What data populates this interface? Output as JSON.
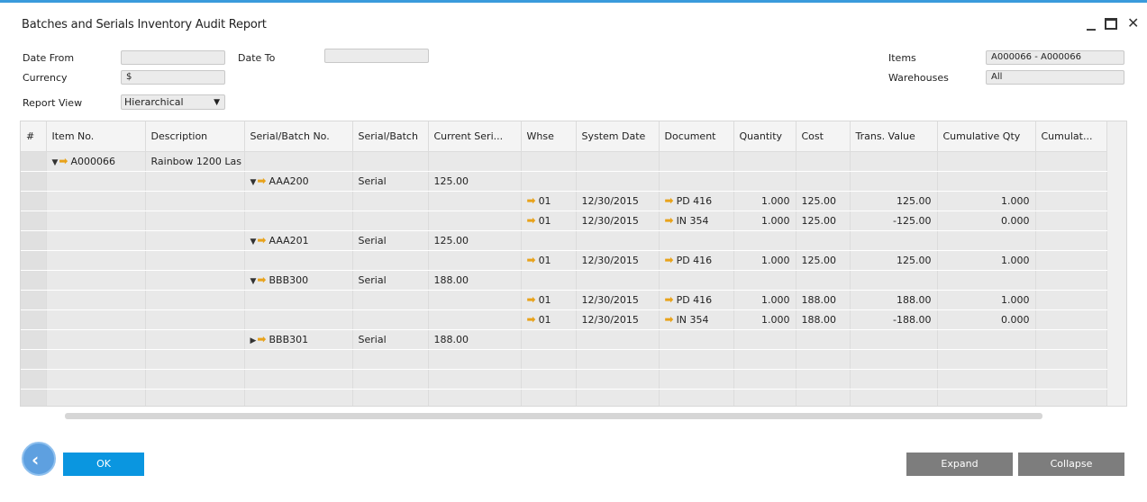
{
  "window": {
    "title": "Batches and Serials Inventory Audit Report"
  },
  "filters": {
    "date_from_label": "Date From",
    "date_from_value": "",
    "date_to_label": "Date To",
    "date_to_value": "",
    "currency_label": "Currency",
    "currency_value": "$",
    "report_view_label": "Report View",
    "report_view_value": "Hierarchical",
    "items_label": "Items",
    "items_value": "A000066 - A000066",
    "warehouses_label": "Warehouses",
    "warehouses_value": "All"
  },
  "grid": {
    "columns": [
      "#",
      "Item No.",
      "Description",
      "Serial/Batch No.",
      "Serial/Batch",
      "Current Seri...",
      "Whse",
      "System Date",
      "Document",
      "Quantity",
      "Cost",
      "Trans. Value",
      "Cumulative Qty",
      "Cumulat..."
    ],
    "rows": [
      {
        "item": "A000066",
        "item_exp": "down",
        "desc": "Rainbow 1200 Las",
        "sb": "",
        "sb_exp": "",
        "sbtype": "",
        "cur": "",
        "whse": "",
        "date": "",
        "doc": "",
        "qty": "",
        "cost": "",
        "tv": "",
        "cq": ""
      },
      {
        "item": "",
        "item_exp": "",
        "desc": "",
        "sb": "AAA200",
        "sb_exp": "down",
        "sbtype": "Serial",
        "cur": "125.00",
        "whse": "",
        "date": "",
        "doc": "",
        "qty": "",
        "cost": "",
        "tv": "",
        "cq": ""
      },
      {
        "item": "",
        "item_exp": "",
        "desc": "",
        "sb": "",
        "sb_exp": "",
        "sbtype": "",
        "cur": "",
        "whse": "01",
        "date": "12/30/2015",
        "doc": "PD 416",
        "qty": "1.000",
        "cost": "125.00",
        "tv": "125.00",
        "cq": "1.000"
      },
      {
        "item": "",
        "item_exp": "",
        "desc": "",
        "sb": "",
        "sb_exp": "",
        "sbtype": "",
        "cur": "",
        "whse": "01",
        "date": "12/30/2015",
        "doc": "IN 354",
        "qty": "1.000",
        "cost": "125.00",
        "tv": "-125.00",
        "cq": "0.000"
      },
      {
        "item": "",
        "item_exp": "",
        "desc": "",
        "sb": "AAA201",
        "sb_exp": "down",
        "sbtype": "Serial",
        "cur": "125.00",
        "whse": "",
        "date": "",
        "doc": "",
        "qty": "",
        "cost": "",
        "tv": "",
        "cq": ""
      },
      {
        "item": "",
        "item_exp": "",
        "desc": "",
        "sb": "",
        "sb_exp": "",
        "sbtype": "",
        "cur": "",
        "whse": "01",
        "date": "12/30/2015",
        "doc": "PD 416",
        "qty": "1.000",
        "cost": "125.00",
        "tv": "125.00",
        "cq": "1.000"
      },
      {
        "item": "",
        "item_exp": "",
        "desc": "",
        "sb": "BBB300",
        "sb_exp": "down",
        "sbtype": "Serial",
        "cur": "188.00",
        "whse": "",
        "date": "",
        "doc": "",
        "qty": "",
        "cost": "",
        "tv": "",
        "cq": ""
      },
      {
        "item": "",
        "item_exp": "",
        "desc": "",
        "sb": "",
        "sb_exp": "",
        "sbtype": "",
        "cur": "",
        "whse": "01",
        "date": "12/30/2015",
        "doc": "PD 416",
        "qty": "1.000",
        "cost": "188.00",
        "tv": "188.00",
        "cq": "1.000"
      },
      {
        "item": "",
        "item_exp": "",
        "desc": "",
        "sb": "",
        "sb_exp": "",
        "sbtype": "",
        "cur": "",
        "whse": "01",
        "date": "12/30/2015",
        "doc": "IN 354",
        "qty": "1.000",
        "cost": "188.00",
        "tv": "-188.00",
        "cq": "0.000"
      },
      {
        "item": "",
        "item_exp": "",
        "desc": "",
        "sb": "BBB301",
        "sb_exp": "right",
        "sbtype": "Serial",
        "cur": "188.00",
        "whse": "",
        "date": "",
        "doc": "",
        "qty": "",
        "cost": "",
        "tv": "",
        "cq": ""
      },
      {
        "item": "",
        "item_exp": "",
        "desc": "",
        "sb": "",
        "sb_exp": "",
        "sbtype": "",
        "cur": "",
        "whse": "",
        "date": "",
        "doc": "",
        "qty": "",
        "cost": "",
        "tv": "",
        "cq": ""
      },
      {
        "item": "",
        "item_exp": "",
        "desc": "",
        "sb": "",
        "sb_exp": "",
        "sbtype": "",
        "cur": "",
        "whse": "",
        "date": "",
        "doc": "",
        "qty": "",
        "cost": "",
        "tv": "",
        "cq": ""
      },
      {
        "item": "",
        "item_exp": "",
        "desc": "",
        "sb": "",
        "sb_exp": "",
        "sbtype": "",
        "cur": "",
        "whse": "",
        "date": "",
        "doc": "",
        "qty": "",
        "cost": "",
        "tv": "",
        "cq": ""
      }
    ]
  },
  "buttons": {
    "ok": "OK",
    "expand": "Expand",
    "collapse": "Collapse"
  },
  "colors": {
    "accent": "#0a96e0",
    "link_arrow": "#e8a21a",
    "gray_button": "#7d7d7d"
  }
}
